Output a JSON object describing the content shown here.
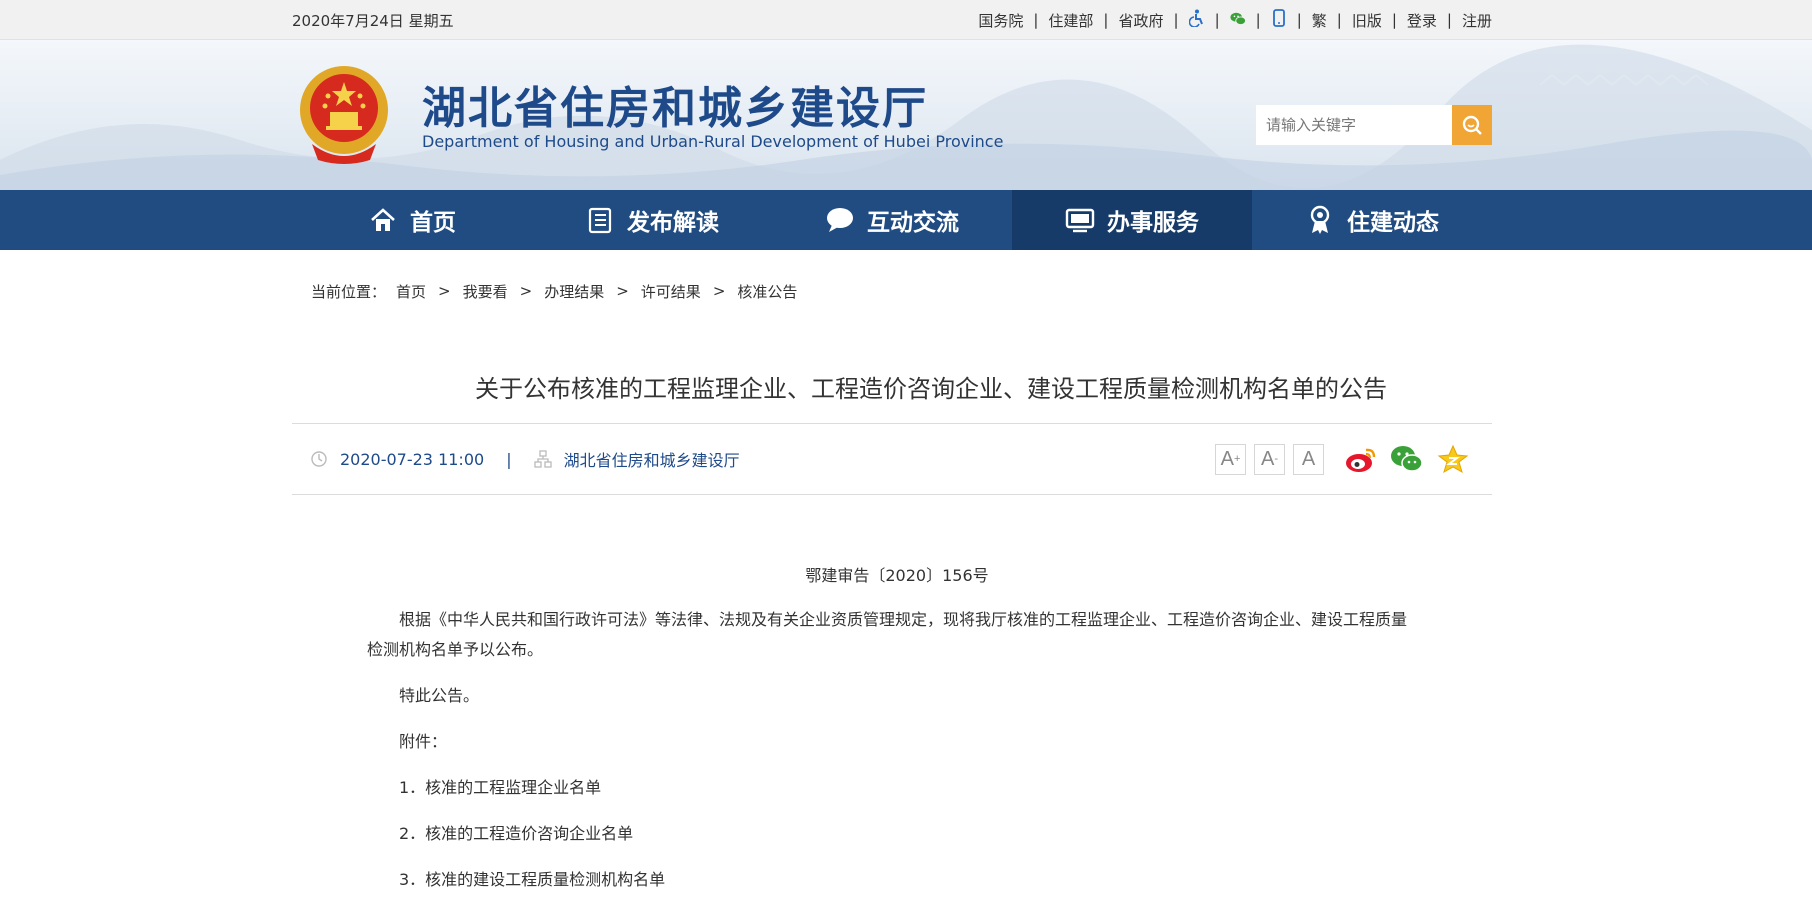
{
  "topbar": {
    "date": "2020年7月24日 星期五",
    "links": [
      "国务院",
      "住建部",
      "省政府"
    ],
    "icons": [
      "accessibility-icon",
      "wechat-icon",
      "mobile-icon"
    ],
    "extra_links": [
      "繁",
      "旧版",
      "登录",
      "注册"
    ]
  },
  "header": {
    "title": "湖北省住房和城乡建设厅",
    "subtitle": "Department of Housing and Urban-Rural Development of Hubei Province",
    "search_placeholder": "请输入关键字"
  },
  "nav": [
    {
      "label": "首页",
      "icon": "home-icon",
      "active": false
    },
    {
      "label": "发布解读",
      "icon": "document-icon",
      "active": false
    },
    {
      "label": "互动交流",
      "icon": "chat-bubble-icon",
      "active": false
    },
    {
      "label": "办事服务",
      "icon": "monitor-icon",
      "active": true
    },
    {
      "label": "住建动态",
      "icon": "award-icon",
      "active": false
    }
  ],
  "breadcrumb": {
    "prefix": "当前位置：",
    "items": [
      "首页",
      "我要看",
      "办理结果",
      "许可结果",
      "核准公告"
    ]
  },
  "article": {
    "title": "关于公布核准的工程监理企业、工程造价咨询企业、建设工程质量检测机构名单的公告",
    "datetime": "2020-07-23 11:00",
    "source": "湖北省住房和城乡建设厅",
    "doc_no": "鄂建审告〔2020〕156号",
    "paragraphs": [
      "根据《中华人民共和国行政许可法》等法律、法规及有关企业资质管理规定，现将我厅核准的工程监理企业、工程造价咨询企业、建设工程质量检测机构名单予以公布。",
      "特此公告。",
      "附件：",
      "1．核准的工程监理企业名单",
      "2．核准的工程造价咨询企业名单",
      "3．核准的建设工程质量检测机构名单"
    ]
  },
  "font_controls": [
    "A+",
    "A-",
    "A"
  ],
  "colors": {
    "nav_bg": "#204c82",
    "nav_active": "#173b69",
    "title_blue": "#1e4a8a",
    "search_btn": "#f0a534"
  }
}
